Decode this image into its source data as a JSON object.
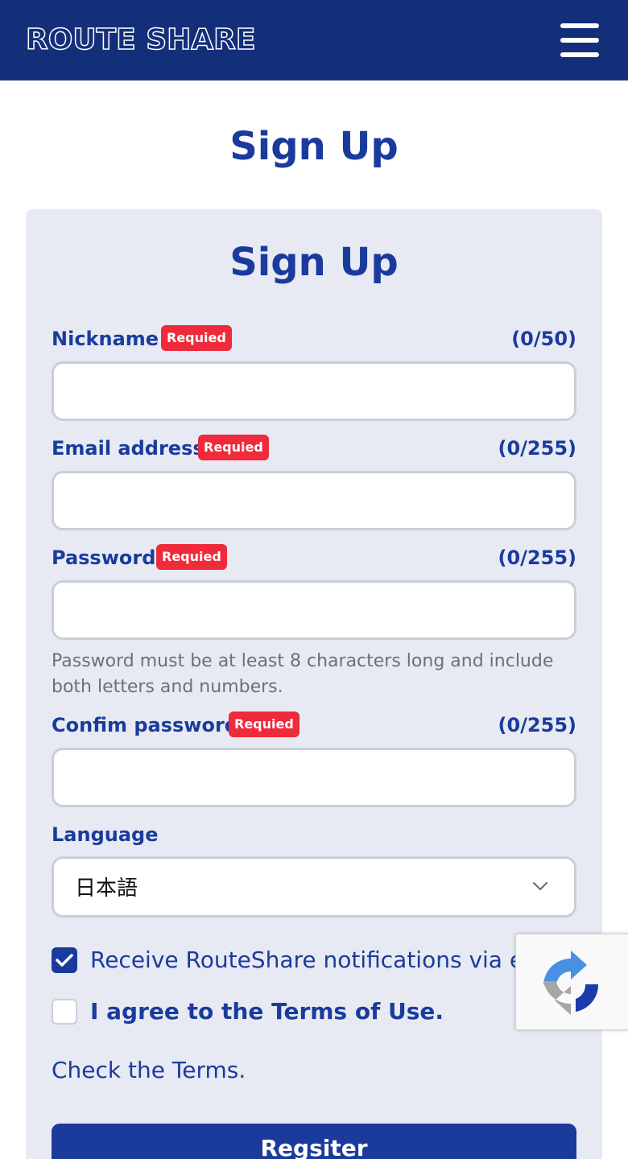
{
  "header": {
    "logo": "ROUTE SHARE",
    "menu_icon": "hamburger-menu-icon"
  },
  "page": {
    "title": "Sign Up"
  },
  "form": {
    "title": "Sign Up",
    "required_badge": "Requied",
    "fields": [
      {
        "label": "Nickname",
        "counter": "(0/50)",
        "value": ""
      },
      {
        "label": "Email address",
        "counter": "(0/255)",
        "value": ""
      },
      {
        "label": "Password",
        "counter": "(0/255)",
        "value": ""
      },
      {
        "label": "Confim password",
        "counter": "(0/255)",
        "value": ""
      }
    ],
    "password_hint": "Password must be at least 8 characters long and include both letters and numbers.",
    "language": {
      "label": "Language",
      "selected": "日本語"
    },
    "notify_checkbox": {
      "label": "Receive RouteShare notifications via email",
      "checked": true
    },
    "terms_checkbox": {
      "label": "I agree to the Terms of Use.",
      "checked": false
    },
    "terms_link": "Check the Terms.",
    "submit": "Regsiter"
  },
  "colors": {
    "primary": "#1b3b9c",
    "header": "#142f7a",
    "badge": "#ef2a3a",
    "card": "#e7eaf3"
  }
}
